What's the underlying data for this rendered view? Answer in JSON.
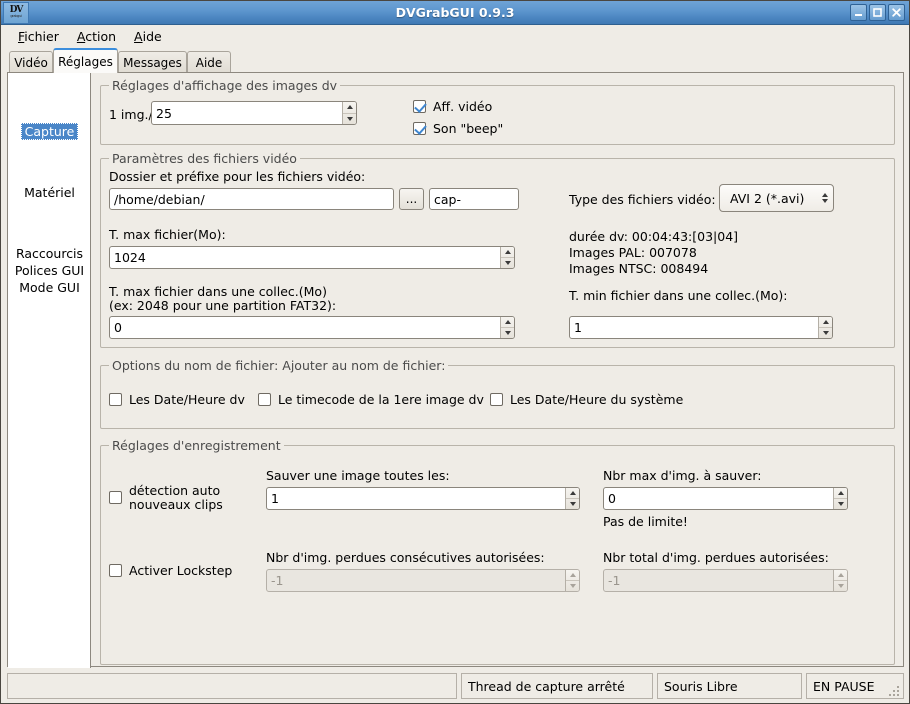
{
  "window": {
    "title": "DVGrabGUI 0.9.3",
    "icon_main": "DV",
    "icon_sub": "grabgui",
    "minimize": "–",
    "maximize": "□",
    "close": "✕"
  },
  "menu": {
    "items": [
      {
        "pre": "",
        "accel": "F",
        "post": "ichier"
      },
      {
        "pre": "",
        "accel": "A",
        "post": "ction"
      },
      {
        "pre": "",
        "accel": "A",
        "post": "ide"
      }
    ],
    "labels": [
      "Fichier",
      "Action",
      "Aide"
    ]
  },
  "tabs": [
    {
      "label": "Vidéo",
      "active": false
    },
    {
      "label": "Réglages",
      "active": true
    },
    {
      "label": "Messages",
      "active": false
    },
    {
      "label": "Aide",
      "active": false
    }
  ],
  "sidebar": {
    "items": [
      {
        "label": "Capture",
        "selected": true
      },
      {
        "label": "Matériel",
        "selected": false
      },
      {
        "label": "Raccourcis",
        "selected": false
      },
      {
        "label": "Polices GUI",
        "selected": false
      },
      {
        "label": "Mode GUI",
        "selected": false
      }
    ]
  },
  "display_group": {
    "legend": "Réglages d'affichage des images dv",
    "frame_label": "1 img./",
    "frame_value": "25",
    "checkbox_video": {
      "label": "Aff. vidéo",
      "checked": true
    },
    "checkbox_beep": {
      "label": "Son \"beep\"",
      "checked": true
    }
  },
  "file_group": {
    "legend": "Paramètres des fichiers vidéo",
    "folder_label": "Dossier et préfixe pour les fichiers vidéo:",
    "folder_value": "/home/debian/",
    "browse_button": "...",
    "prefix_value": "cap-",
    "type_label": "Type des fichiers vidéo:",
    "type_value": "AVI 2 (*.avi)",
    "maxsize_label": "T. max fichier(Mo):",
    "maxsize_value": "1024",
    "info_duration": "durée dv: 00:04:43:[03|04]",
    "info_pal": "Images PAL: 007078",
    "info_ntsc": "Images NTSC: 008494",
    "coll_max_label_l1": "T. max fichier dans une collec.(Mo)",
    "coll_max_label_l2": "(ex: 2048 pour une partition FAT32):",
    "coll_max_value": "0",
    "coll_min_label": "T. min fichier dans une collec.(Mo):",
    "coll_min_value": "1"
  },
  "filename_group": {
    "legend": "Options du nom de fichier: Ajouter au nom de fichier:",
    "checkboxes": [
      {
        "label": "Les Date/Heure dv",
        "checked": false
      },
      {
        "label": "Le timecode de la 1ere image dv",
        "checked": false
      },
      {
        "label": "Les Date/Heure du système",
        "checked": false
      }
    ]
  },
  "record_group": {
    "legend": "Réglages d'enregistrement",
    "autodetect": {
      "label_l1": "détection auto",
      "label_l2": "nouveaux clips",
      "checked": false
    },
    "save_every_label": "Sauver une image toutes les:",
    "save_every_value": "1",
    "max_images_label": "Nbr max d'img. à sauver:",
    "max_images_value": "0",
    "no_limit_note": "Pas de limite!",
    "lockstep": {
      "label": "Activer Lockstep",
      "checked": false
    },
    "consec_lost_label": "Nbr d'img. perdues consécutives autorisées:",
    "consec_lost_value": "-1",
    "total_lost_label": "Nbr total d'img. perdues autorisées:",
    "total_lost_value": "-1"
  },
  "statusbar": {
    "cells": [
      "",
      "Thread de capture arrêté",
      "Souris Libre",
      "EN PAUSE"
    ]
  },
  "colors": {
    "titlebar_start": "#6fa3d6",
    "titlebar_end": "#3f79b4",
    "window_bg": "#efece6",
    "selection": "#4a86c8",
    "tab_accent": "#3c8edd",
    "checkmark": "#3f86cf"
  }
}
